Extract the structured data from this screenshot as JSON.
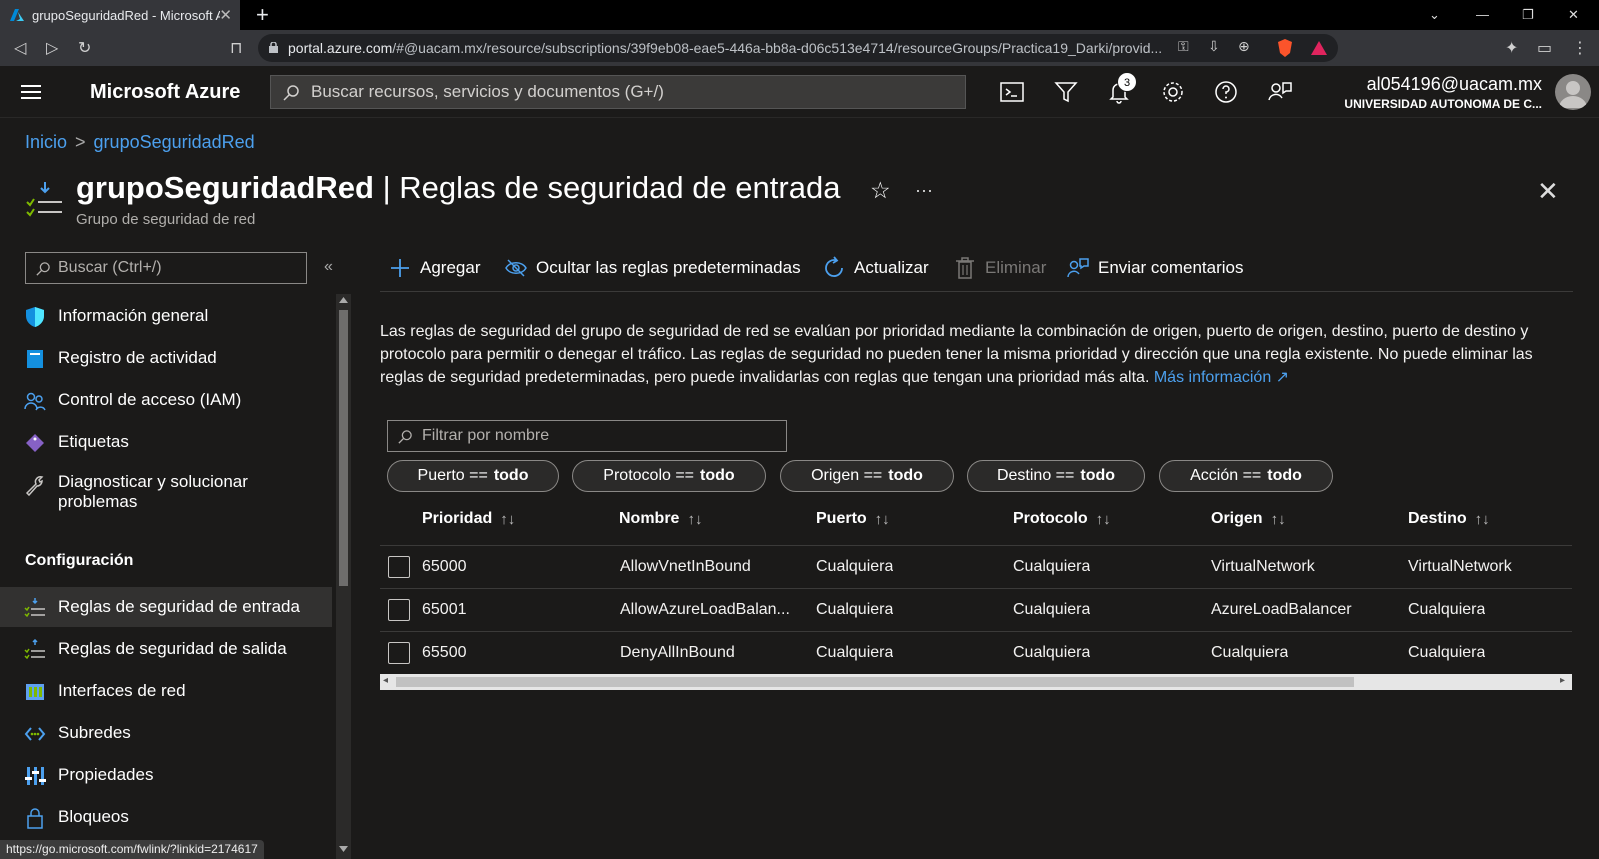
{
  "browser": {
    "tab_title": "grupoSeguridadRed - Microsoft Azure",
    "new_tab": "+",
    "url_host": "portal.azure.com",
    "url_rest": "/#@uacam.mx/resource/subscriptions/39f9eb08-eae5-446a-bb8a-d06c513e4714/resourceGroups/Practica19_Darki/provid..."
  },
  "header": {
    "brand": "Microsoft Azure",
    "search_placeholder": "Buscar recursos, servicios y documentos (G+/)",
    "notifications_count": "3",
    "user_email": "al054196@uacam.mx",
    "user_org": "UNIVERSIDAD AUTONOMA DE C..."
  },
  "breadcrumb": {
    "home": "Inicio",
    "current": "grupoSeguridadRed"
  },
  "page": {
    "title_resource": "grupoSeguridadRed",
    "title_sep": " | ",
    "title_section": "Reglas de seguridad de entrada",
    "subtitle": "Grupo de seguridad de red",
    "star": "☆",
    "more": "···",
    "close": "✕"
  },
  "sidebar": {
    "search_placeholder": "Buscar (Ctrl+/)",
    "collapse": "«",
    "items": [
      {
        "label": "Información general"
      },
      {
        "label": "Registro de actividad"
      },
      {
        "label": "Control de acceso (IAM)"
      },
      {
        "label": "Etiquetas"
      },
      {
        "label": "Diagnosticar y solucionar",
        "label2": "problemas"
      }
    ],
    "group": "Configuración",
    "config_items": [
      {
        "label": "Reglas de seguridad de entrada"
      },
      {
        "label": "Reglas de seguridad de salida"
      },
      {
        "label": "Interfaces de red"
      },
      {
        "label": "Subredes"
      },
      {
        "label": "Propiedades"
      },
      {
        "label": "Bloqueos"
      }
    ]
  },
  "toolbar": {
    "add": "Agregar",
    "hide_defaults": "Ocultar las reglas predeterminadas",
    "refresh": "Actualizar",
    "delete": "Eliminar",
    "feedback": "Enviar comentarios"
  },
  "description": {
    "text": "Las reglas de seguridad del grupo de seguridad de red se evalúan por prioridad mediante la combinación de origen, puerto de origen, destino, puerto de destino y protocolo para permitir o denegar el tráfico. Las reglas de seguridad no pueden tener la misma prioridad y dirección que una regla existente. No puede eliminar las reglas de seguridad predeterminadas, pero puede invalidarlas con reglas que tengan una prioridad más alta.",
    "link": "Más información"
  },
  "filter": {
    "placeholder": "Filtrar por nombre",
    "pills": [
      {
        "key": "Puerto ==",
        "value": "todo"
      },
      {
        "key": "Protocolo ==",
        "value": "todo"
      },
      {
        "key": "Origen ==",
        "value": "todo"
      },
      {
        "key": "Destino ==",
        "value": "todo"
      },
      {
        "key": "Acción ==",
        "value": "todo"
      }
    ]
  },
  "grid": {
    "columns": [
      "Prioridad",
      "Nombre",
      "Puerto",
      "Protocolo",
      "Origen",
      "Destino"
    ],
    "sort_glyph": "↑↓",
    "rows": [
      [
        "65000",
        "AllowVnetInBound",
        "Cualquiera",
        "Cualquiera",
        "VirtualNetwork",
        "VirtualNetwork"
      ],
      [
        "65001",
        "AllowAzureLoadBalan...",
        "Cualquiera",
        "Cualquiera",
        "AzureLoadBalancer",
        "Cualquiera"
      ],
      [
        "65500",
        "DenyAllInBound",
        "Cualquiera",
        "Cualquiera",
        "Cualquiera",
        "Cualquiera"
      ]
    ]
  },
  "status_url": "https://go.microsoft.com/fwlink/?linkid=2174617",
  "colors": {
    "accent": "#4ca0ee",
    "background": "#1b1a19",
    "selected": "#323130"
  }
}
